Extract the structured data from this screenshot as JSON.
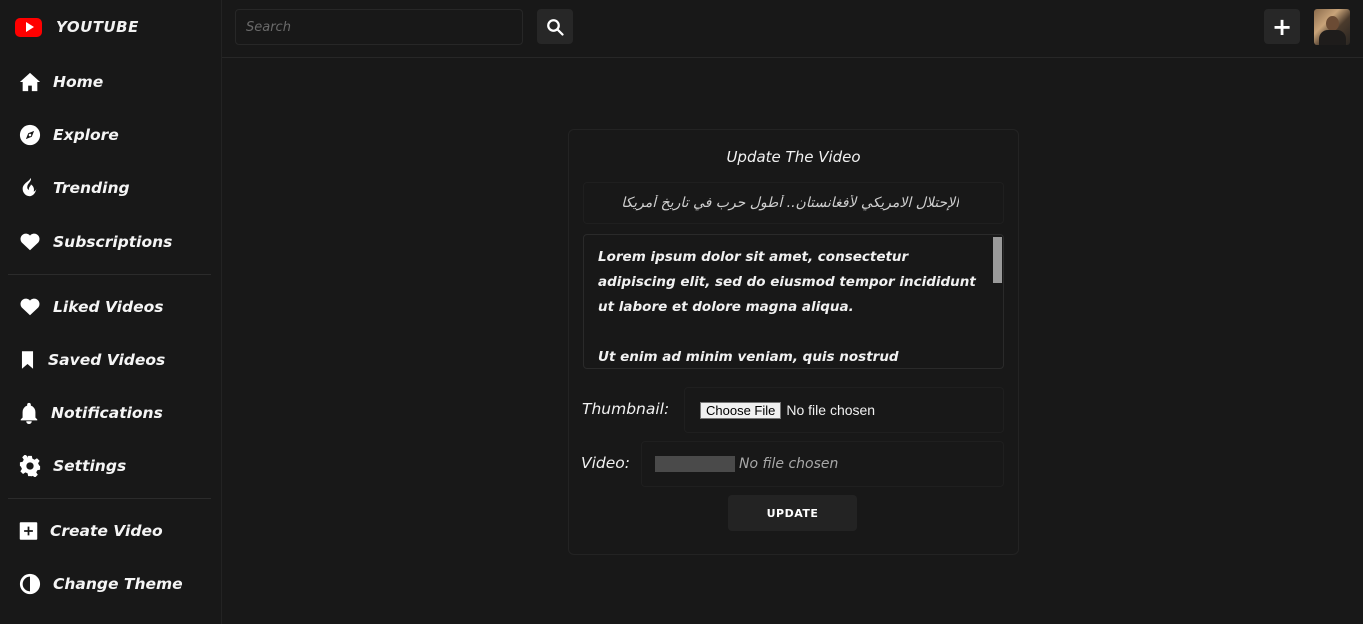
{
  "app": {
    "brand": "YOUTUBE"
  },
  "sidebar": {
    "items": [
      {
        "label": "Home",
        "icon": "home-icon"
      },
      {
        "label": "Explore",
        "icon": "compass-icon"
      },
      {
        "label": "Trending",
        "icon": "fire-icon"
      },
      {
        "label": "Subscriptions",
        "icon": "heart-icon"
      },
      {
        "label": "Liked Videos",
        "icon": "heart-icon"
      },
      {
        "label": "Saved Videos",
        "icon": "bookmark-icon"
      },
      {
        "label": "Notifications",
        "icon": "bell-icon"
      },
      {
        "label": "Settings",
        "icon": "gear-icon"
      },
      {
        "label": "Create Video",
        "icon": "plus-square-icon"
      },
      {
        "label": "Change Theme",
        "icon": "half-circle-icon"
      }
    ]
  },
  "header": {
    "search_placeholder": "Search",
    "search_icon": "search-icon",
    "create_icon": "plus-icon"
  },
  "form": {
    "title": "Update The Video",
    "video_title_value": "الإحتلال الامريكي لأفغانستان.. أطول حرب في تاريخ أمريكا",
    "description_p1": "Lorem ipsum dolor sit amet, consectetur adipiscing elit, sed do eiusmod tempor incididunt ut labore et dolore magna aliqua.",
    "description_p2": "Ut enim ad minim veniam, quis nostrud exercitation",
    "thumbnail_label": "Thumbnail:",
    "thumbnail_button": "Choose File",
    "thumbnail_status": "No file chosen",
    "video_label": "Video:",
    "video_status": "No file chosen",
    "submit_label": "UPDATE"
  },
  "colors": {
    "background": "#181818",
    "surface": "#272727",
    "brand_red": "#ff0000"
  }
}
